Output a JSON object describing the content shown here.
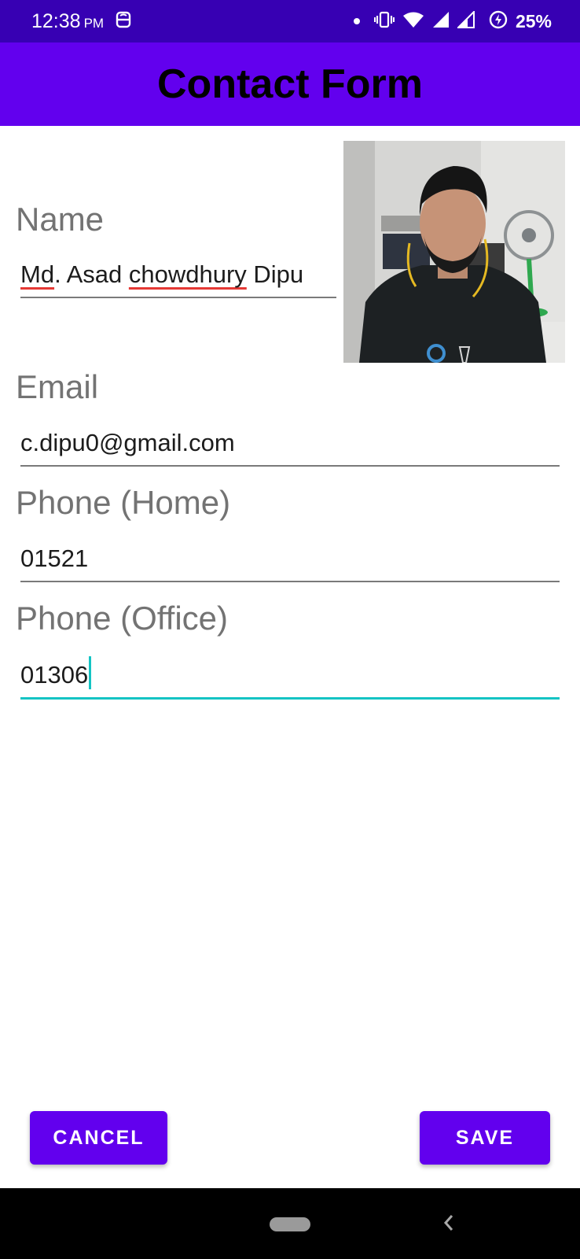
{
  "status_bar": {
    "time": "12:38",
    "ampm": "PM",
    "battery": "25%",
    "icons": [
      "app-notification-icon",
      "vibrate-icon",
      "wifi-icon",
      "signal-icon",
      "signal-icon",
      "battery-saver-icon"
    ]
  },
  "app_bar": {
    "title": "Contact Form"
  },
  "form": {
    "name": {
      "label": "Name",
      "value_parts": [
        "Md",
        ". Asad ",
        "chowdhury",
        " Dipu"
      ]
    },
    "email": {
      "label": "Email",
      "value": "c.dipu0@gmail.com"
    },
    "phone_home": {
      "label": "Phone (Home)",
      "value": "01521"
    },
    "phone_office": {
      "label": "Phone (Office)",
      "value": "01306"
    }
  },
  "buttons": {
    "cancel": "CANCEL",
    "save": "SAVE"
  },
  "colors": {
    "status_bar": "#3700b3",
    "primary": "#6200ee",
    "focus_underline": "#14c4c4",
    "spell_error": "#e53935"
  }
}
